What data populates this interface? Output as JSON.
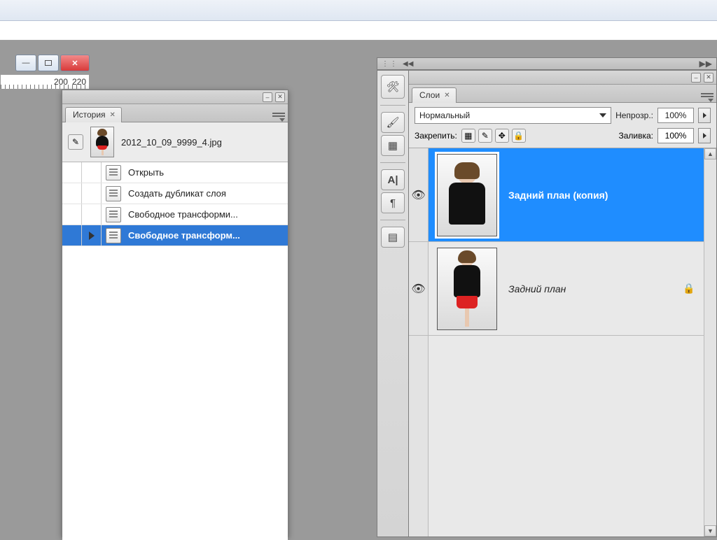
{
  "ruler": {
    "tick1": "200",
    "tick2": "220"
  },
  "history_panel": {
    "tab": "История",
    "file": "2012_10_09_9999_4.jpg",
    "items": [
      {
        "label": "Открыть",
        "selected": false,
        "cursor": false
      },
      {
        "label": "Создать дубликат слоя",
        "selected": false,
        "cursor": false
      },
      {
        "label": "Свободное трансформи...",
        "selected": false,
        "cursor": false
      },
      {
        "label": "Свободное трансформ...",
        "selected": true,
        "cursor": true
      }
    ]
  },
  "layers_panel": {
    "tab": "Слои",
    "blend_mode": "Нормальный",
    "opacity_label": "Непрозр.:",
    "opacity_value": "100%",
    "lock_label": "Закрепить:",
    "fill_label": "Заливка:",
    "fill_value": "100%",
    "layers": [
      {
        "name": "Задний план (копия)",
        "selected": true,
        "visible": true,
        "locked": false,
        "thumb": "bust"
      },
      {
        "name": "Задний план",
        "selected": false,
        "visible": true,
        "locked": true,
        "thumb": "full"
      }
    ]
  }
}
